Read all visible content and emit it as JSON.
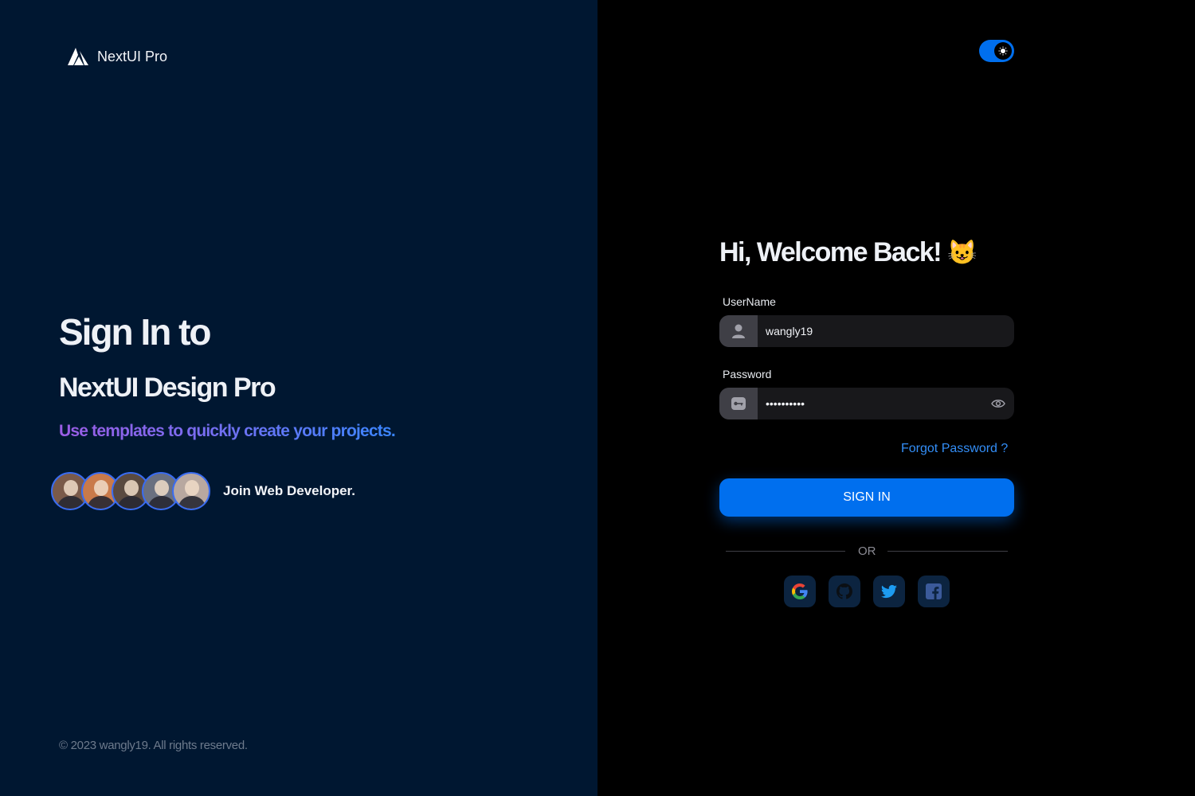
{
  "brand": {
    "name": "NextUI Pro",
    "logo_icon": "nextui-logo-icon"
  },
  "hero": {
    "title": "Sign In to",
    "subtitle": "NextUI Design Pro",
    "tagline": "Use templates to quickly create your projects.",
    "join_text": "Join Web Developer.",
    "avatar_count": 5
  },
  "footer": {
    "copyright": "© 2023 wangly19. All rights reserved."
  },
  "theme_toggle": {
    "state": "on",
    "icon": "sun-icon"
  },
  "form": {
    "welcome": "Hi, Welcome Back!",
    "welcome_emoji": "😺",
    "username_label": "UserName",
    "username_value": "wangly19",
    "password_label": "Password",
    "password_value": "••••••••••",
    "forgot_link": "Forgot Password ?",
    "signin_button": "SIGN IN",
    "or_divider": "OR"
  },
  "social": [
    "google-icon",
    "github-icon",
    "twitter-icon",
    "facebook-icon"
  ],
  "colors": {
    "left_bg": "#001731",
    "right_bg": "#000000",
    "primary": "#006fee",
    "link": "#338ef7"
  }
}
